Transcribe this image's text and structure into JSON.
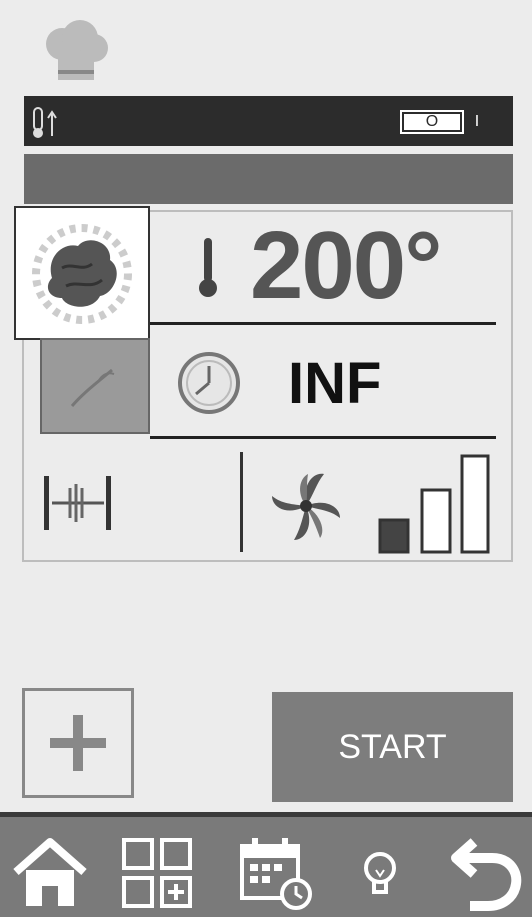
{
  "status": {
    "toggle_off": "O",
    "toggle_on": "I"
  },
  "program": {
    "temperature": "200°",
    "time": "INF",
    "fan_level": 1,
    "fan_levels_total": 3
  },
  "actions": {
    "start_label": "START"
  },
  "nav": {
    "items": [
      "home-icon",
      "programs-grid-icon",
      "schedule-calendar-icon",
      "light-bulb-icon",
      "back-arrow-icon"
    ]
  },
  "colors": {
    "background": "#ececec",
    "dark": "#2c2c2c",
    "accent_grey": "#7d7d7d"
  }
}
